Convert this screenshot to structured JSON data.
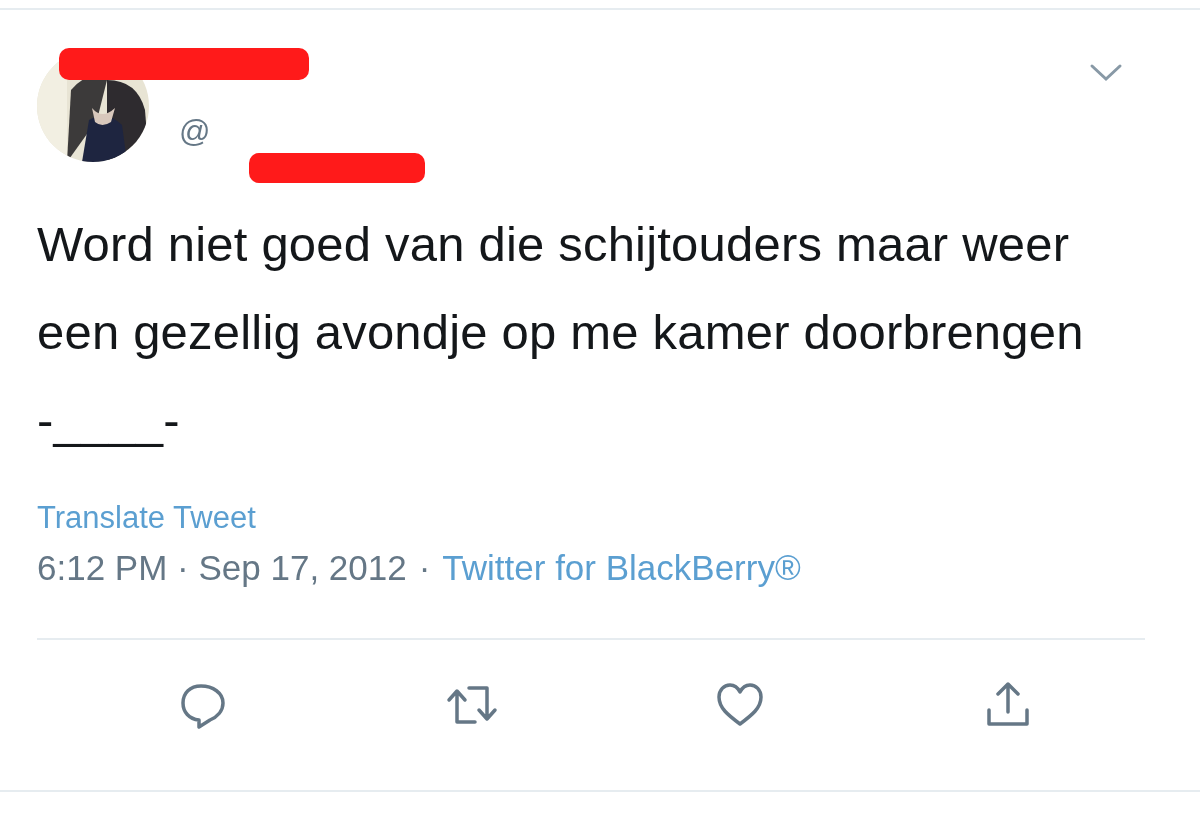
{
  "tweet": {
    "author": {
      "handle": "@"
    },
    "text": "Word niet goed van die schijtouders maar weer een gezellig avondje op me kamer doorbrengen -____-",
    "translate_link": "Translate Tweet",
    "timestamp": "6:12 PM · Sep 17, 2012",
    "separator": "·",
    "source": "Twitter for BlackBerry®",
    "actions": [
      {
        "kind": "reply"
      },
      {
        "kind": "retweet"
      },
      {
        "kind": "like"
      },
      {
        "kind": "share"
      }
    ]
  }
}
